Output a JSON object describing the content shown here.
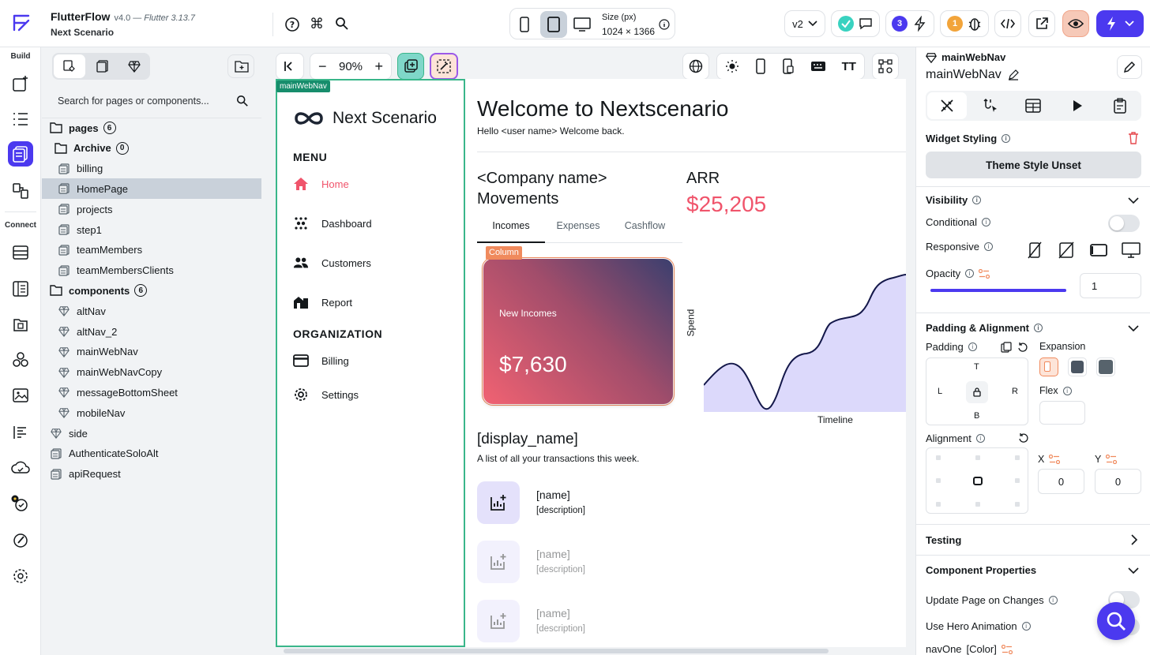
{
  "app": {
    "name": "FlutterFlow",
    "version": "v4.0",
    "flutter_version": "Flutter 3.13.7",
    "project": "Next Scenario"
  },
  "topbar": {
    "size_label": "Size (px)",
    "size_value": "1024 × 1366",
    "branch": "v2",
    "issues_count": "3",
    "warnings_count": "1"
  },
  "rail": {
    "build_label": "Build",
    "connect_label": "Connect"
  },
  "tree": {
    "search_placeholder": "Search for pages or components...",
    "pages_label": "pages",
    "pages_count": "6",
    "archive_label": "Archive",
    "archive_count": "0",
    "pages": [
      "billing",
      "HomePage",
      "projects",
      "step1",
      "teamMembers",
      "teamMembersClients"
    ],
    "components_label": "components",
    "components_count": "6",
    "components": [
      "altNav",
      "altNav_2",
      "mainWebNav",
      "mainWebNavCopy",
      "messageBottomSheet",
      "mobileNav"
    ],
    "root_items": [
      "side",
      "AuthenticateSoloAlt",
      "apiRequest"
    ]
  },
  "canvas": {
    "zoom": "90%",
    "widget_tag": "mainWebNav",
    "column_tag": "Column"
  },
  "app_preview": {
    "brand": "Next Scenario",
    "menu_label": "MENU",
    "menu_items": [
      "Home",
      "Dashboard",
      "Customers",
      "Report"
    ],
    "org_label": "ORGANIZATION",
    "org_items": [
      "Billing",
      "Settings"
    ],
    "welcome_title": "Welcome to Nextscenario",
    "welcome_sub": "Hello <user name> Welcome back.",
    "company_line1": "<Company name>",
    "company_line2": "Movements",
    "tabs": [
      "Incomes",
      "Expenses",
      "Cashflow"
    ],
    "card_label": "New Incomes",
    "card_value": "$7,630",
    "arr_label": "ARR",
    "arr_value": "$25,205",
    "chart_ylabel": "Spend",
    "chart_xlabel": "Timeline",
    "list_title": "[display_name]",
    "list_sub": "A list of all your transactions this week.",
    "list_items": [
      {
        "name": "[name]",
        "description": "[description]"
      },
      {
        "name": "[name]",
        "description": "[description]"
      },
      {
        "name": "[name]",
        "description": "[description]"
      }
    ]
  },
  "props": {
    "widget_name": "mainWebNav",
    "widget_title": "mainWebNav",
    "widget_styling": "Widget Styling",
    "theme_style": "Theme Style Unset",
    "visibility": "Visibility",
    "conditional": "Conditional",
    "responsive": "Responsive",
    "opacity": "Opacity",
    "opacity_value": "1",
    "opacity_level": 1,
    "padding_alignment": "Padding & Alignment",
    "padding": "Padding",
    "expansion": "Expansion",
    "pad_t": "T",
    "pad_l": "L",
    "pad_r": "R",
    "pad_b": "B",
    "flex": "Flex",
    "alignment": "Alignment",
    "x_label": "X",
    "y_label": "Y",
    "x_value": "0",
    "y_value": "0",
    "testing": "Testing",
    "component_properties": "Component Properties",
    "update_page": "Update Page on Changes",
    "hero_animation": "Use Hero Animation",
    "nav_one": "navOne",
    "nav_one_type": "[Color]"
  },
  "colors": {
    "accent": "#4b39ef",
    "nav_border": "#39b68a",
    "home_active": "#f0546b",
    "arr_value": "#f0546b",
    "card_gradient_start": "#f16272",
    "card_gradient_end": "#3b3f6e",
    "chart_fill": "#dcd9fb"
  }
}
